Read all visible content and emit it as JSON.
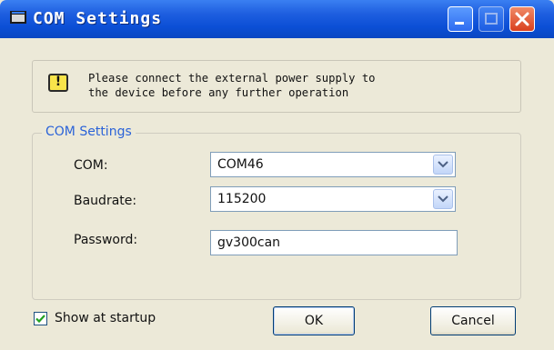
{
  "window": {
    "title": "COM Settings",
    "controls": [
      "minimize-icon",
      "maximize-icon",
      "close-icon"
    ]
  },
  "warning": {
    "icon": "warning-icon",
    "icon_glyph": "!",
    "text": "Please connect the external power supply to\nthe device before any further operation"
  },
  "group": {
    "legend": "COM Settings",
    "com": {
      "label": "COM:",
      "value": "COM46"
    },
    "baudrate": {
      "label": "Baudrate:",
      "value": "115200"
    },
    "password": {
      "label": "Password:",
      "value": "gv300can"
    }
  },
  "footer": {
    "show_at_startup_label": "Show at startup",
    "show_at_startup_checked": true,
    "ok_label": "OK",
    "cancel_label": "Cancel"
  },
  "colors": {
    "titlebar": "#0b4fd6",
    "legend": "#2b63d8",
    "close": "#d9401e",
    "warning_fill": "#f8e44a"
  }
}
